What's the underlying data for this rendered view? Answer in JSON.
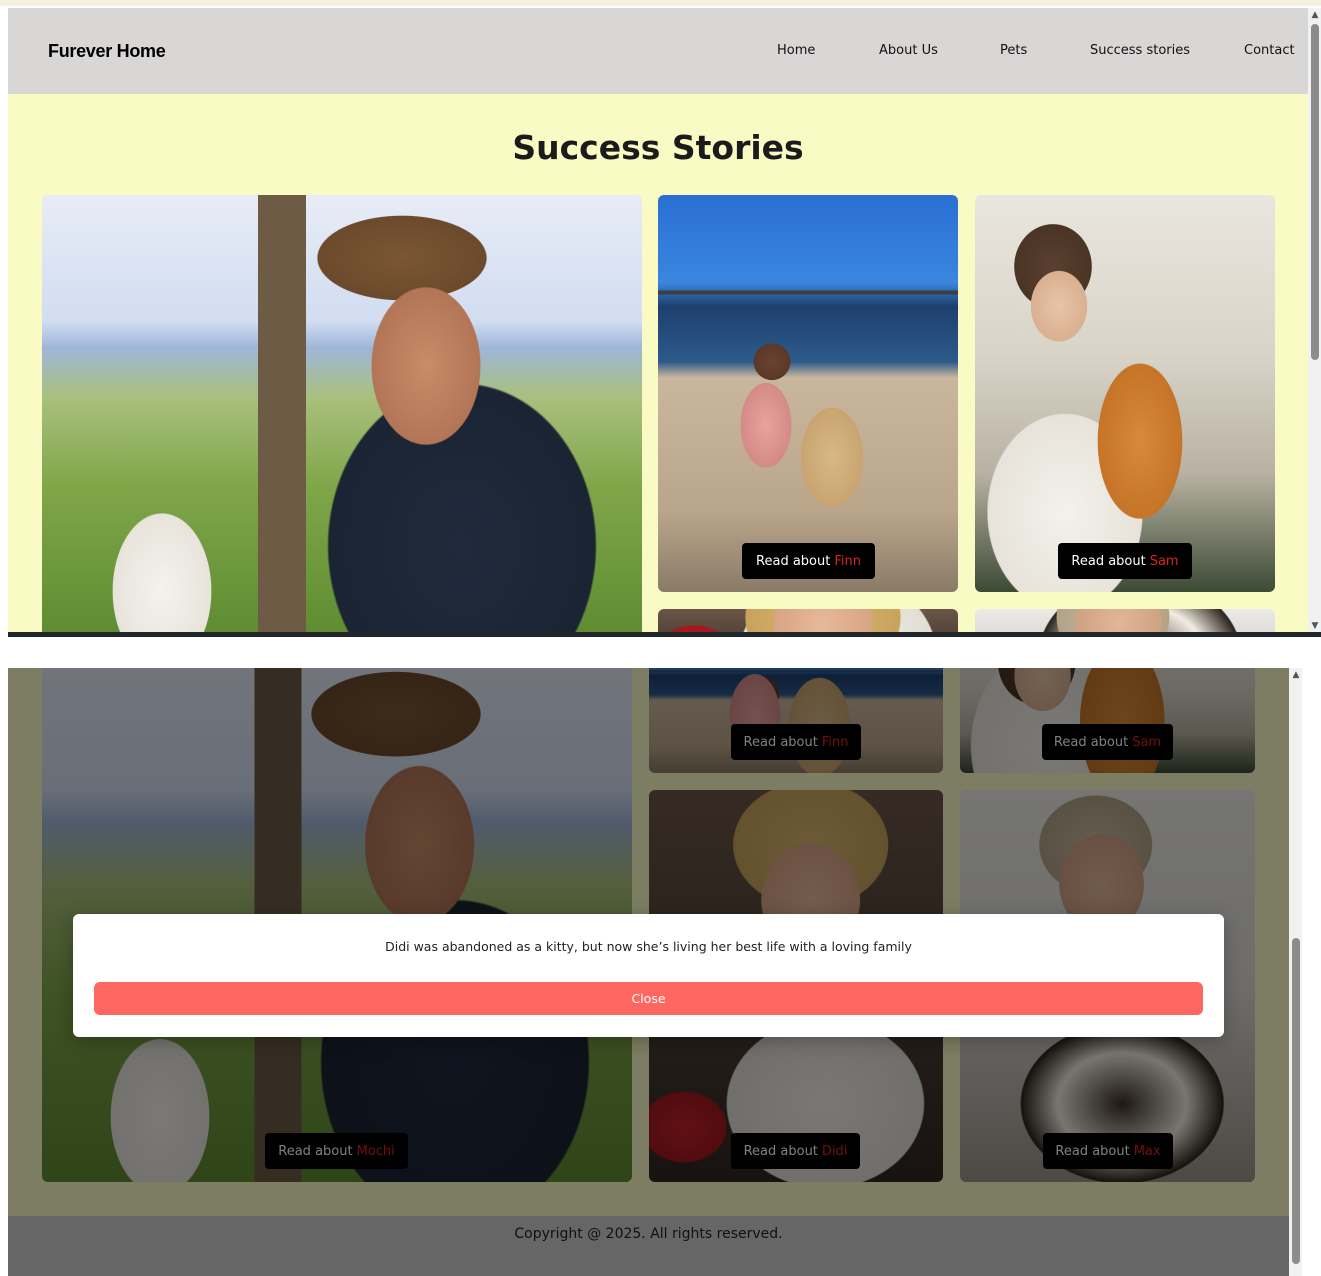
{
  "header": {
    "brand": "Furever Home",
    "nav": [
      {
        "label": "Home"
      },
      {
        "label": "About Us"
      },
      {
        "label": "Pets"
      },
      {
        "label": "Success stories"
      },
      {
        "label": "Contact"
      }
    ]
  },
  "page": {
    "title": "Success Stories",
    "read_prefix": "Read about",
    "stories": [
      {
        "pet": "Mochi"
      },
      {
        "pet": "Finn"
      },
      {
        "pet": "Sam"
      },
      {
        "pet": "Didi"
      },
      {
        "pet": "Max"
      }
    ]
  },
  "modal": {
    "message": "Didi was abandoned as a kitty, but now she’s living her best life with a loving family",
    "close_label": "Close"
  },
  "footer": {
    "copyright": "Copyright @ 2025. All rights reserved."
  },
  "colors": {
    "navbar_bg": "#d9d6d6",
    "page_bg": "#f9fac4",
    "pet_name": "#e02020",
    "close_button": "#fe6661",
    "button_bg": "#000000"
  }
}
